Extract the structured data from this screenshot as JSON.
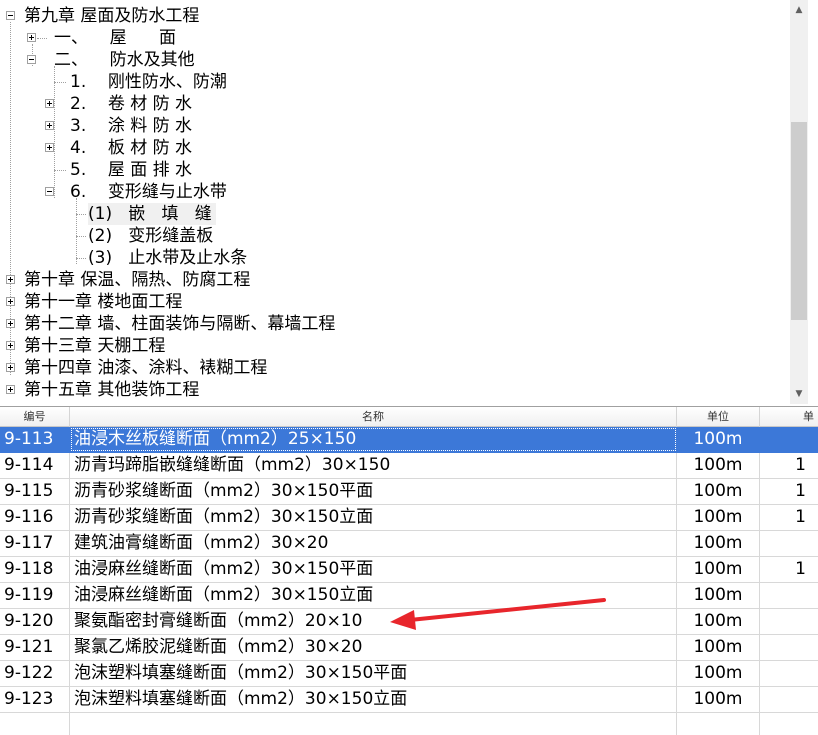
{
  "tree": {
    "items": [
      {
        "label": "第九章 屋面及防水工程",
        "expander": "minus"
      },
      {
        "label": "一、    屋      面",
        "expander": "plus"
      },
      {
        "label": "二、    防水及其他",
        "expander": "minus"
      },
      {
        "label": "1.    刚性防水、防潮",
        "expander": "none"
      },
      {
        "label": "2.    卷 材 防 水",
        "expander": "plus"
      },
      {
        "label": "3.    涂 料 防 水",
        "expander": "plus"
      },
      {
        "label": "4.    板 材 防 水",
        "expander": "plus"
      },
      {
        "label": "5.    屋 面 排 水",
        "expander": "none"
      },
      {
        "label": "6.    变形缝与止水带",
        "expander": "minus"
      },
      {
        "label": "(1)   嵌   填   缝",
        "expander": "none",
        "selected": true
      },
      {
        "label": "(2)   变形缝盖板",
        "expander": "none"
      },
      {
        "label": "(3)   止水带及止水条",
        "expander": "none"
      },
      {
        "label": "第十章 保温、隔热、防腐工程",
        "expander": "plus"
      },
      {
        "label": "第十一章 楼地面工程",
        "expander": "plus"
      },
      {
        "label": "第十二章 墙、柱面装饰与隔断、幕墙工程",
        "expander": "plus"
      },
      {
        "label": "第十三章 天棚工程",
        "expander": "plus"
      },
      {
        "label": "第十四章 油漆、涂料、裱糊工程",
        "expander": "plus"
      },
      {
        "label": "第十五章 其他装饰工程",
        "expander": "plus"
      }
    ],
    "scroll_up_icon": "triangle-up",
    "scroll_down_icon": "triangle-down"
  },
  "table": {
    "headers": {
      "code": "编号",
      "name": "名称",
      "unit": "单位",
      "extra": "单"
    },
    "rows": [
      {
        "code": "9-113",
        "name": "油浸木丝板缝断面（mm2）25×150",
        "unit": "100m",
        "extra": "",
        "selected": true
      },
      {
        "code": "9-114",
        "name": "沥青玛蹄脂嵌缝缝断面（mm2）30×150",
        "unit": "100m",
        "extra": "1"
      },
      {
        "code": "9-115",
        "name": "沥青砂浆缝断面（mm2）30×150平面",
        "unit": "100m",
        "extra": "1"
      },
      {
        "code": "9-116",
        "name": "沥青砂浆缝断面（mm2）30×150立面",
        "unit": "100m",
        "extra": "1"
      },
      {
        "code": "9-117",
        "name": "建筑油膏缝断面（mm2）30×20",
        "unit": "100m",
        "extra": ""
      },
      {
        "code": "9-118",
        "name": "油浸麻丝缝断面（mm2）30×150平面",
        "unit": "100m",
        "extra": "1"
      },
      {
        "code": "9-119",
        "name": "油浸麻丝缝断面（mm2）30×150立面",
        "unit": "100m",
        "extra": ""
      },
      {
        "code": "9-120",
        "name": "聚氨酯密封膏缝断面（mm2）20×10",
        "unit": "100m",
        "extra": ""
      },
      {
        "code": "9-121",
        "name": "聚氯乙烯胶泥缝断面（mm2）30×20",
        "unit": "100m",
        "extra": ""
      },
      {
        "code": "9-122",
        "name": "泡沫塑料填塞缝断面（mm2）30×150平面",
        "unit": "100m",
        "extra": ""
      },
      {
        "code": "9-123",
        "name": "泡沫塑料填塞缝断面（mm2）30×150立面",
        "unit": "100m",
        "extra": ""
      }
    ]
  },
  "colors": {
    "selection": "#3c78d8",
    "annotation_arrow": "#e8262c",
    "grid_line": "#d8d8d8"
  }
}
